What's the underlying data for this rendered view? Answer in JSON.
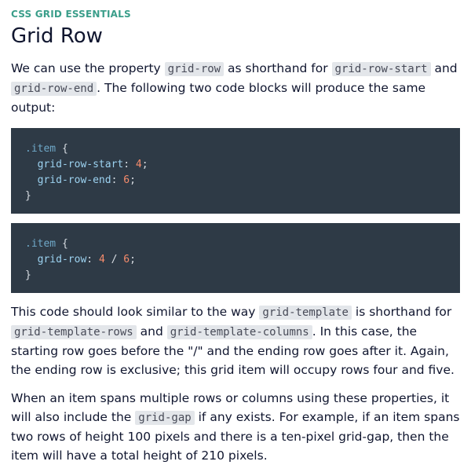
{
  "kicker": "CSS GRID ESSENTIALS",
  "title": "Grid Row",
  "p1": {
    "t1": "We can use the property ",
    "c1": "grid-row",
    "t2": " as shorthand for ",
    "c2": "grid-row-start",
    "t3": " and ",
    "c3": "grid-row-end",
    "t4": ". The following two code blocks will produce the same output:"
  },
  "code1": {
    "selector": ".item",
    "open": " {",
    "line1_prop": "grid-row-start",
    "line1_val": "4",
    "line2_prop": "grid-row-end",
    "line2_val": "6",
    "close": "}"
  },
  "code2": {
    "selector": ".item",
    "open": " {",
    "line1_prop": "grid-row",
    "line1_val_a": "4",
    "line1_sep": " / ",
    "line1_val_b": "6",
    "close": "}"
  },
  "p2": {
    "t1": "This code should look similar to the way ",
    "c1": "grid-template",
    "t2": " is shorthand for ",
    "c2": "grid-template-rows",
    "t3": " and ",
    "c3": "grid-template-columns",
    "t4": ". In this case, the starting row goes before the \"/\" and the ending row goes after it. Again, the ending row is exclusive; this grid item will occupy rows four and five."
  },
  "p3": {
    "t1": "When an item spans multiple rows or columns using these properties, it will also include the ",
    "c1": "grid-gap",
    "t2": " if any exists. For example, if an item spans two rows of height 100 pixels and there is a ten-pixel grid-gap, then the item will have a total height of 210 pixels."
  }
}
